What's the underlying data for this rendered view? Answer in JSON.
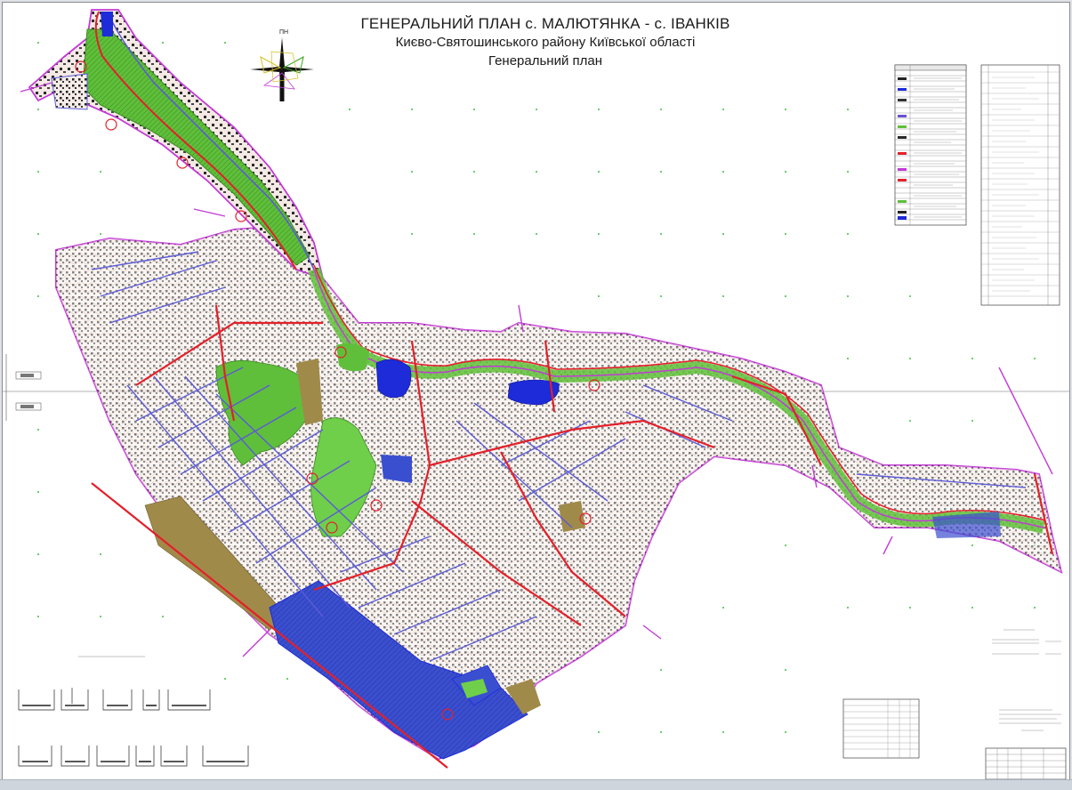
{
  "title": {
    "line1": "ГЕНЕРАЛЬНИЙ ПЛАН с. МАЛЮТЯНКА  - с. ІВАНКІВ",
    "line2": "Києво-Святошинського району Київської області",
    "line3": "Генеральний план"
  },
  "compass": {
    "label": "ПН"
  },
  "colors": {
    "green_zone": "#5fbf3a",
    "residential": "#5a5a5a",
    "water": "#1d2bd8",
    "main_road": "#e3202a",
    "secondary_road": "#5b5bd6",
    "boundary": "#c23bd6",
    "industrial": "#3a4fd0",
    "agricultural": "#a08a4a"
  },
  "icons": [
    "compass-rose-icon",
    "pond-icon",
    "grid-cross-icon"
  ]
}
